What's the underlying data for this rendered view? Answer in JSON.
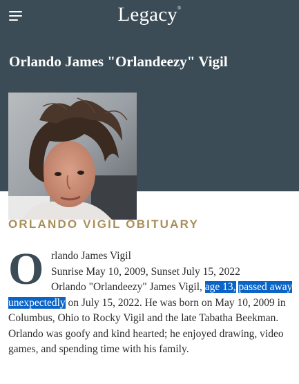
{
  "header": {
    "logo_text": "Legacy",
    "logo_mark": "®"
  },
  "page": {
    "title": "Orlando James \"Orlandeezy\" Vigil"
  },
  "obituary": {
    "section_title": "ORLANDO VIGIL OBITUARY",
    "drop_cap": "O",
    "line1": "rlando James Vigil",
    "line2": "Sunrise May 10, 2009, Sunset July 15, 2022",
    "line3_pre": "Orlando \"Orlandeezy\" James Vigil, ",
    "highlight1": "age 13",
    "highlight_comma": ",",
    "highlight2": "passed away unexpectedly",
    "after_highlight": " on July 15, 2022. He was born on May 10, 2009 in Columbus, Ohio to Rocky Vigil and the late Tabatha Beekman. Orlando was goofy and kind hearted; he enjoyed drawing, video games, and spending time with his family."
  },
  "colors": {
    "header_bg": "#3b4c56",
    "section_title": "#a98e57",
    "highlight": "#0a64c7"
  }
}
